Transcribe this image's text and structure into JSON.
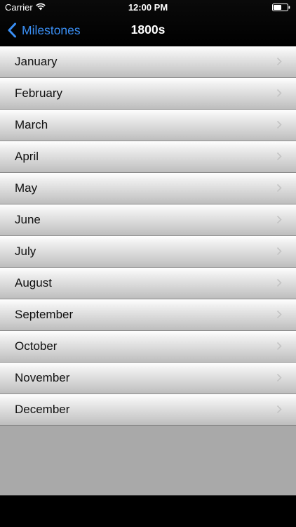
{
  "status_bar": {
    "carrier": "Carrier",
    "time": "12:00 PM",
    "wifi_icon": "wifi-icon",
    "battery_icon": "battery-icon"
  },
  "nav": {
    "back_label": "Milestones",
    "title": "1800s",
    "back_icon": "chevron-left-icon",
    "accent_color": "#3a8ff5"
  },
  "list": {
    "row_icon": "chevron-right-icon",
    "items": [
      {
        "label": "January"
      },
      {
        "label": "February"
      },
      {
        "label": "March"
      },
      {
        "label": "April"
      },
      {
        "label": "May"
      },
      {
        "label": "June"
      },
      {
        "label": "July"
      },
      {
        "label": "August"
      },
      {
        "label": "September"
      },
      {
        "label": "October"
      },
      {
        "label": "November"
      },
      {
        "label": "December"
      }
    ]
  }
}
